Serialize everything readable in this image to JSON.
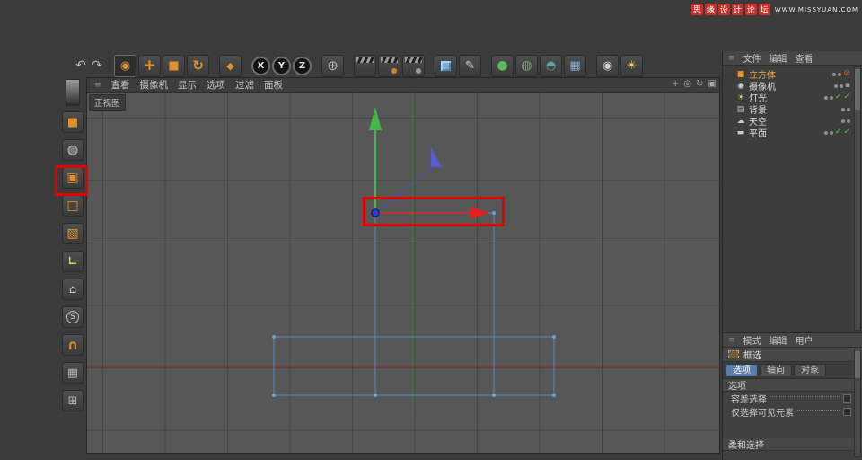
{
  "colors": {
    "annotation_red": "#e40000",
    "axis_x_red": "#e02020",
    "axis_y_green": "#44b844",
    "axis_z_blue": "#5a5ad2",
    "wireframe_blue": "#5583ab",
    "selected_orange": "#eead3d",
    "active_tab_blue": "#5a7ea8",
    "check_green": "#4ec44e",
    "watermark_red": "#c9302c",
    "viewport_gray": "#575757"
  },
  "watermark": {
    "site_name_chars": [
      "思",
      "缘",
      "设",
      "计",
      "论",
      "坛"
    ],
    "site_url": "WWW.MISSYUAN.COM"
  },
  "icons": {
    "menu_handle": "≡",
    "undo": "↶",
    "redo": "↷",
    "live_selection": "◉",
    "move": "+",
    "scale": "■",
    "rotate": "↻",
    "last_tool": "◆",
    "axis_x": "X",
    "axis_y": "Y",
    "axis_z": "Z",
    "coord_system": "⊕",
    "spline_pen": "✎",
    "generators": "●",
    "deformers": "◍",
    "boole": "◓",
    "environment": "▦",
    "camera": "◉",
    "light": "☀",
    "pan": "+",
    "zoom": "◎",
    "rotate_view": "↻",
    "maximize": "▣",
    "check": "✓",
    "slash": "⊘",
    "tag_box": "▪",
    "make_editable": "■",
    "model_mode": "◍",
    "points_mode": "▣",
    "edges_mode": "□",
    "polygons_mode": "▧",
    "enable_axis": "∟",
    "workplane": "⌂",
    "snap": "S",
    "magnet": "∩",
    "texture": "▦",
    "coordinates": "⊞"
  },
  "viewport": {
    "menu": [
      "查看",
      "摄像机",
      "显示",
      "选项",
      "过滤",
      "面板"
    ],
    "view_label": "正视图"
  },
  "object_manager": {
    "menu": [
      "文件",
      "编辑",
      "查看"
    ],
    "objects": [
      {
        "name": "立方体",
        "icon_glyph": "■",
        "selected": true
      },
      {
        "name": "摄像机",
        "icon_glyph": "◉"
      },
      {
        "name": "灯光",
        "icon_glyph": "☀",
        "enabled_checks": true
      },
      {
        "name": "背景",
        "icon_glyph": "▤"
      },
      {
        "name": "天空",
        "icon_glyph": "☁"
      },
      {
        "name": "平面",
        "icon_glyph": "▬",
        "enabled_checks": true
      }
    ]
  },
  "attribute_manager": {
    "menu": [
      "模式",
      "编辑",
      "用户"
    ],
    "tool_name": "框选",
    "tabs": [
      "选项",
      "轴向",
      "对象"
    ],
    "active_tab": "选项",
    "sections": {
      "options": "选项",
      "soft": "柔和选择"
    },
    "options": [
      {
        "label": "容差选择",
        "checked": false
      },
      {
        "label": "仅选择可见元素",
        "checked": false
      }
    ]
  }
}
